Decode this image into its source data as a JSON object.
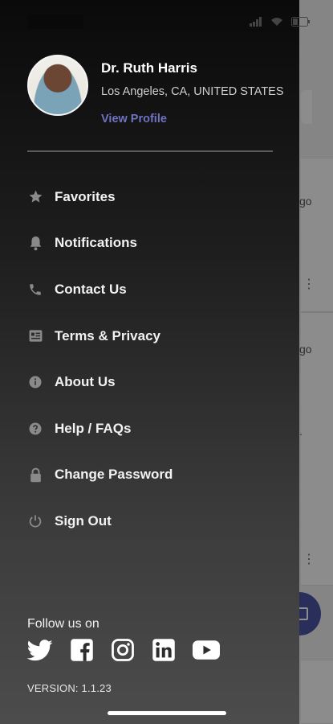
{
  "profile": {
    "name": "Dr. Ruth Harris",
    "location": "Los Angeles, CA, UNITED STATES",
    "view_profile": "View Profile"
  },
  "menu": {
    "items": [
      {
        "label": "Favorites",
        "icon": "star-icon"
      },
      {
        "label": "Notifications",
        "icon": "bell-icon"
      },
      {
        "label": "Contact Us",
        "icon": "phone-icon"
      },
      {
        "label": "Terms & Privacy",
        "icon": "document-icon"
      },
      {
        "label": "About Us",
        "icon": "info-icon"
      },
      {
        "label": "Help / FAQs",
        "icon": "help-icon"
      },
      {
        "label": "Change Password",
        "icon": "lock-icon"
      },
      {
        "label": "Sign Out",
        "icon": "power-icon"
      }
    ]
  },
  "social": {
    "label": "Follow us on",
    "icons": [
      "twitter-icon",
      "facebook-icon",
      "instagram-icon",
      "linkedin-icon",
      "youtube-icon"
    ]
  },
  "footer": {
    "version": "VERSION: 1.1.23"
  },
  "background": {
    "ago_1": "go",
    "ago_2": "go",
    "ellipsis": "."
  },
  "colors": {
    "accent": "#6f73c2",
    "fab": "#4e55a6",
    "drawer_top": "#0a0a0a",
    "drawer_bottom": "#4c4c4c"
  }
}
